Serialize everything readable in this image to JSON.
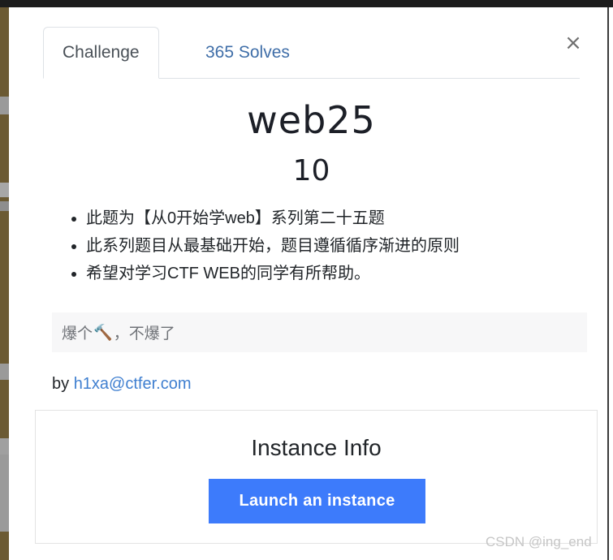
{
  "backdrop": {
    "strip_color": "#6b5a33",
    "strip_accent_color": "#9a9a9a",
    "top_bar_color": "#1c1c1c",
    "right_edge_color": "#3a3a3a"
  },
  "modal": {
    "close_icon": "close-icon",
    "close_glyph": "×",
    "tabs": [
      {
        "label": "Challenge",
        "active": true
      },
      {
        "label": "365 Solves",
        "active": false
      }
    ]
  },
  "challenge": {
    "title": "web25",
    "value": "10",
    "description_bullets": [
      "此题为【从0开始学web】系列第二十五题",
      "此系列题目从最基础开始，题目遵循循序渐进的原则",
      "希望对学习CTF WEB的同学有所帮助。"
    ],
    "code_text_before": "爆个",
    "code_emoji": "🔨",
    "code_text_after": "，不爆了",
    "author_prefix": "by ",
    "author_email": "h1xa@ctfer.com"
  },
  "instance": {
    "title": "Instance Info",
    "launch_label": "Launch an instance",
    "button_color": "#3d7bfb"
  },
  "watermark": {
    "text": "CSDN @ing_end"
  }
}
